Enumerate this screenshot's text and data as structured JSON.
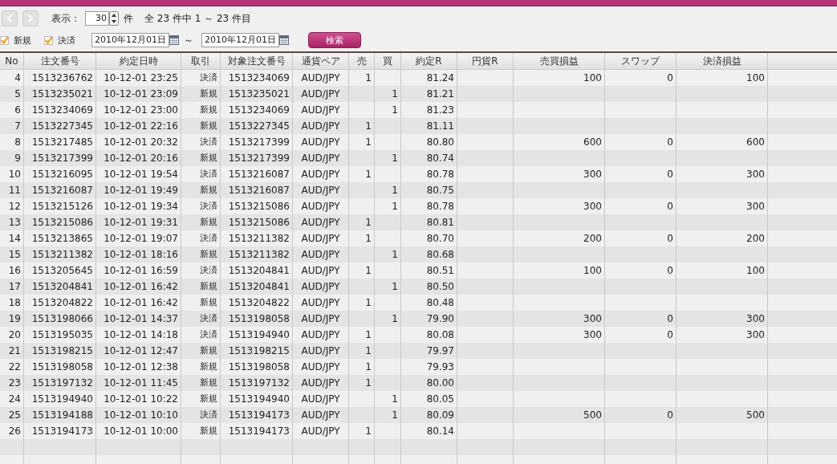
{
  "toolbar": {
    "prev_disabled": true,
    "next_disabled": true,
    "display_label": "表示：",
    "page_size": "30",
    "unit": "件",
    "summary": "全 23 件中 1 ～ 23 件目"
  },
  "filters": {
    "options": [
      {
        "label": "新規",
        "checked": true
      },
      {
        "label": "決済",
        "checked": true
      }
    ],
    "date_from": "2010年12月01日",
    "separator": "～",
    "date_to": "2010年12月01日",
    "search_button": "検索"
  },
  "table": {
    "columns": [
      "No",
      "注文番号",
      "約定日時",
      "取引",
      "対象注文番号",
      "通貨ペア",
      "売",
      "買",
      "約定R",
      "円貨R",
      "売買損益",
      "スワップ",
      "決済損益"
    ],
    "rows": [
      [
        "4",
        "1513236762",
        "10-12-01 23:25",
        "決済",
        "1513234069",
        "AUD/JPY",
        "1",
        null,
        "81.24",
        null,
        "100",
        "0",
        "100"
      ],
      [
        "5",
        "1513235021",
        "10-12-01 23:09",
        "新規",
        "1513235021",
        "AUD/JPY",
        null,
        "1",
        "81.21",
        null,
        null,
        null,
        null
      ],
      [
        "6",
        "1513234069",
        "10-12-01 23:00",
        "新規",
        "1513234069",
        "AUD/JPY",
        null,
        "1",
        "81.23",
        null,
        null,
        null,
        null
      ],
      [
        "7",
        "1513227345",
        "10-12-01 22:16",
        "新規",
        "1513227345",
        "AUD/JPY",
        "1",
        null,
        "81.11",
        null,
        null,
        null,
        null
      ],
      [
        "8",
        "1513217485",
        "10-12-01 20:32",
        "決済",
        "1513217399",
        "AUD/JPY",
        "1",
        null,
        "80.80",
        null,
        "600",
        "0",
        "600"
      ],
      [
        "9",
        "1513217399",
        "10-12-01 20:16",
        "新規",
        "1513217399",
        "AUD/JPY",
        null,
        "1",
        "80.74",
        null,
        null,
        null,
        null
      ],
      [
        "10",
        "1513216095",
        "10-12-01 19:54",
        "決済",
        "1513216087",
        "AUD/JPY",
        "1",
        null,
        "80.78",
        null,
        "300",
        "0",
        "300"
      ],
      [
        "11",
        "1513216087",
        "10-12-01 19:49",
        "新規",
        "1513216087",
        "AUD/JPY",
        null,
        "1",
        "80.75",
        null,
        null,
        null,
        null
      ],
      [
        "12",
        "1513215126",
        "10-12-01 19:34",
        "決済",
        "1513215086",
        "AUD/JPY",
        null,
        "1",
        "80.78",
        null,
        "300",
        "0",
        "300"
      ],
      [
        "13",
        "1513215086",
        "10-12-01 19:31",
        "新規",
        "1513215086",
        "AUD/JPY",
        "1",
        null,
        "80.81",
        null,
        null,
        null,
        null
      ],
      [
        "14",
        "1513213865",
        "10-12-01 19:07",
        "決済",
        "1513211382",
        "AUD/JPY",
        "1",
        null,
        "80.70",
        null,
        "200",
        "0",
        "200"
      ],
      [
        "15",
        "1513211382",
        "10-12-01 18:16",
        "新規",
        "1513211382",
        "AUD/JPY",
        null,
        "1",
        "80.68",
        null,
        null,
        null,
        null
      ],
      [
        "16",
        "1513205645",
        "10-12-01 16:59",
        "決済",
        "1513204841",
        "AUD/JPY",
        "1",
        null,
        "80.51",
        null,
        "100",
        "0",
        "100"
      ],
      [
        "17",
        "1513204841",
        "10-12-01 16:42",
        "新規",
        "1513204841",
        "AUD/JPY",
        null,
        "1",
        "80.50",
        null,
        null,
        null,
        null
      ],
      [
        "18",
        "1513204822",
        "10-12-01 16:42",
        "新規",
        "1513204822",
        "AUD/JPY",
        "1",
        null,
        "80.48",
        null,
        null,
        null,
        null
      ],
      [
        "19",
        "1513198066",
        "10-12-01 14:37",
        "決済",
        "1513198058",
        "AUD/JPY",
        null,
        "1",
        "79.90",
        null,
        "300",
        "0",
        "300"
      ],
      [
        "20",
        "1513195035",
        "10-12-01 14:18",
        "決済",
        "1513194940",
        "AUD/JPY",
        "1",
        null,
        "80.08",
        null,
        "300",
        "0",
        "300"
      ],
      [
        "21",
        "1513198215",
        "10-12-01 12:47",
        "新規",
        "1513198215",
        "AUD/JPY",
        "1",
        null,
        "79.97",
        null,
        null,
        null,
        null
      ],
      [
        "22",
        "1513198058",
        "10-12-01 12:38",
        "新規",
        "1513198058",
        "AUD/JPY",
        "1",
        null,
        "79.93",
        null,
        null,
        null,
        null
      ],
      [
        "23",
        "1513197132",
        "10-12-01 11:45",
        "新規",
        "1513197132",
        "AUD/JPY",
        "1",
        null,
        "80.00",
        null,
        null,
        null,
        null
      ],
      [
        "24",
        "1513194940",
        "10-12-01 10:22",
        "新規",
        "1513194940",
        "AUD/JPY",
        null,
        "1",
        "80.05",
        null,
        null,
        null,
        null
      ],
      [
        "25",
        "1513194188",
        "10-12-01 10:10",
        "決済",
        "1513194173",
        "AUD/JPY",
        null,
        "1",
        "80.09",
        null,
        "500",
        "0",
        "500"
      ],
      [
        "26",
        "1513194173",
        "10-12-01 10:00",
        "新規",
        "1513194173",
        "AUD/JPY",
        "1",
        null,
        "80.14",
        null,
        null,
        null,
        null
      ]
    ]
  }
}
